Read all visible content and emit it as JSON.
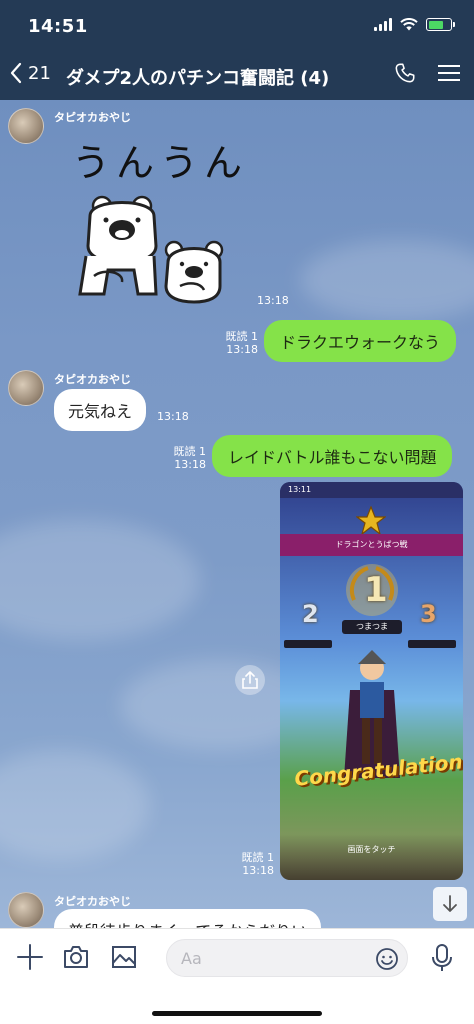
{
  "status": {
    "time": "14:51"
  },
  "header": {
    "back_count": "21",
    "title": "ダメプ2人のパチンコ奮闘記 (4)"
  },
  "messages": [
    {
      "id": "m1",
      "sender": "タピオカおやじ",
      "sticker_text": "うんうん",
      "time": "13:18"
    },
    {
      "id": "m2",
      "read": "既読 1",
      "time": "13:18",
      "text": "ドラクエウォークなう"
    },
    {
      "id": "m3",
      "sender": "タピオカおやじ",
      "text": "元気ねえ",
      "time": "13:18"
    },
    {
      "id": "m4",
      "read": "既読 1",
      "time": "13:18",
      "text": "レイドバトル誰もこない問題"
    },
    {
      "id": "m5",
      "read": "既読 1",
      "time": "13:18",
      "image": {
        "status_time": "13:11",
        "event_title": "ドラゴンとうばつ戦",
        "player_name": "つまつま",
        "rank_first": "1",
        "rank_second": "2",
        "rank_third": "3",
        "congrats": "Congratulations!",
        "touch_hint": "画面をタッチ"
      }
    },
    {
      "id": "m6",
      "sender": "タピオカおやじ",
      "text": "普段徒歩りまくってるからだりい"
    }
  ],
  "input": {
    "placeholder": "Aa"
  },
  "colors": {
    "header_bg": "#243a55",
    "my_bubble": "#85e249",
    "their_bubble": "#ffffff",
    "battery": "#4cd964"
  }
}
